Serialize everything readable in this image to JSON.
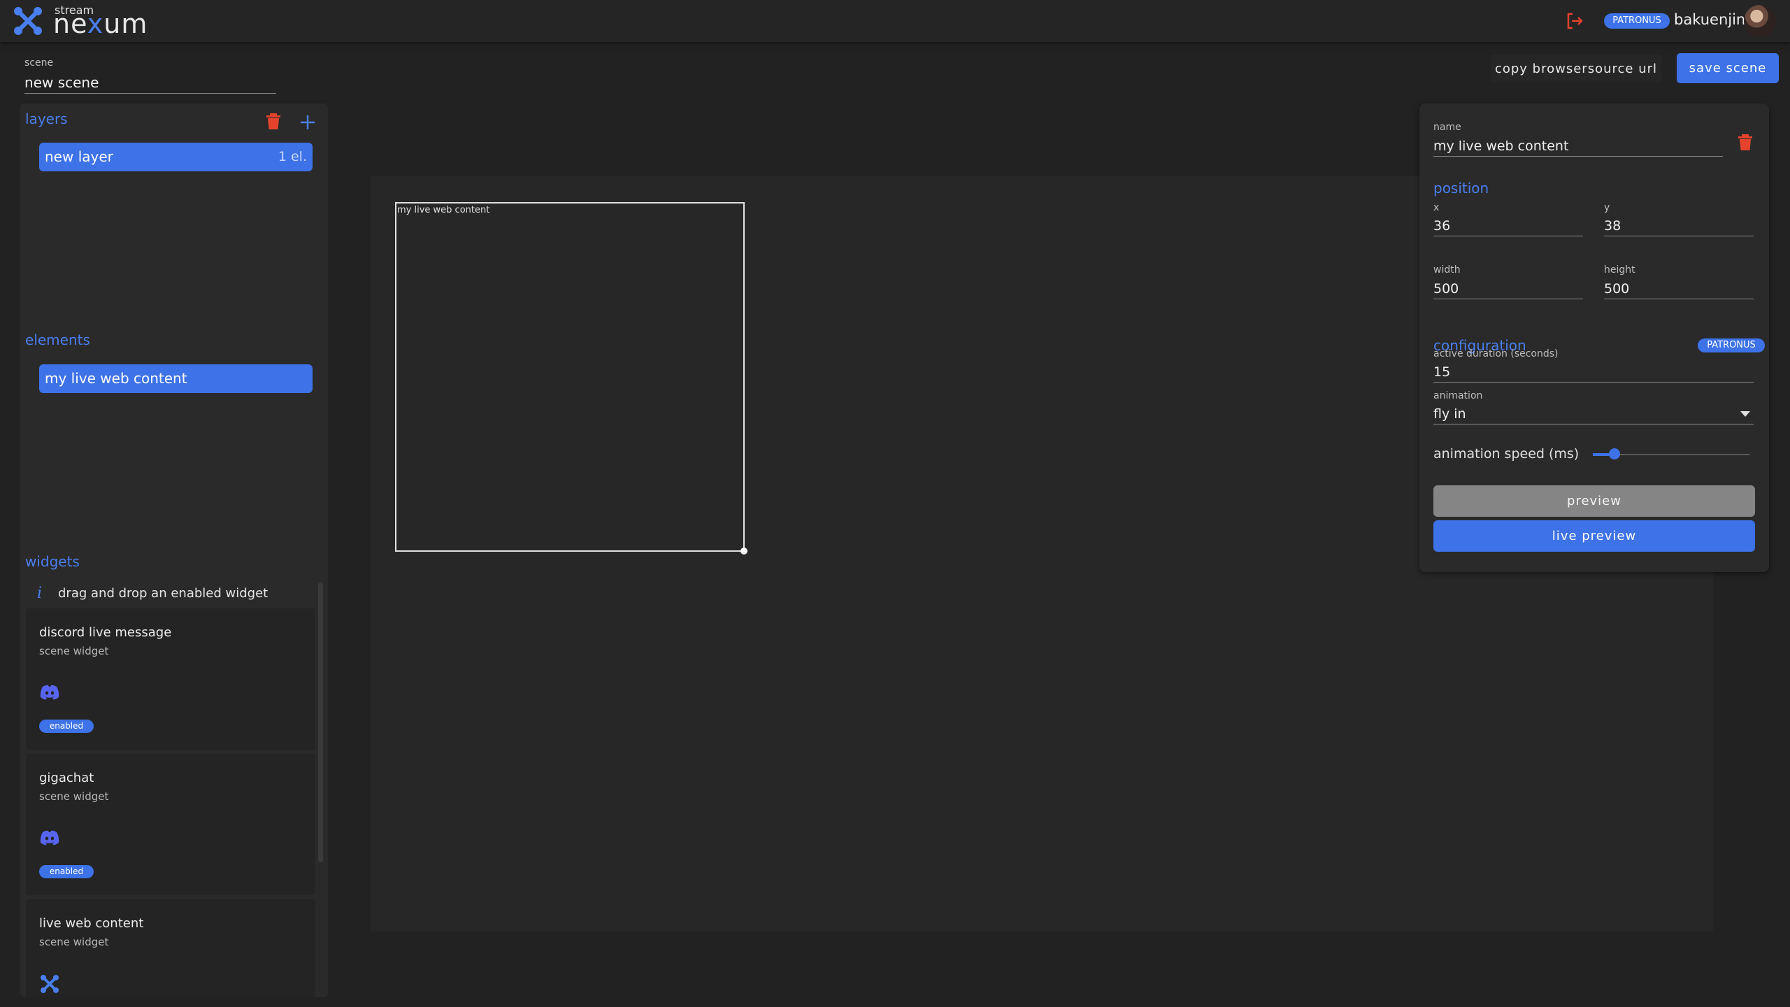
{
  "header": {
    "logo_small": "stream",
    "logo_big_pre": "ne",
    "logo_big_x": "x",
    "logo_big_post": "um",
    "badge": "PATRONUS",
    "username": "bakuenjin",
    "logout_icon": "logout-icon",
    "accent": "#3d72e8",
    "danger": "#e5432c"
  },
  "scene": {
    "label": "scene",
    "value": "new scene"
  },
  "actions": {
    "copy_url": "copy browsersource url",
    "save": "save scene"
  },
  "layers": {
    "title": "layers",
    "items": [
      {
        "label": "new layer",
        "count": "1 el."
      }
    ]
  },
  "elements": {
    "title": "elements",
    "items": [
      {
        "label": "my live web content"
      }
    ]
  },
  "widgets": {
    "title": "widgets",
    "info": "drag and drop an enabled widget",
    "items": [
      {
        "title": "discord live message",
        "subtitle": "scene widget",
        "icon": "discord-icon",
        "badge": "enabled"
      },
      {
        "title": "gigachat",
        "subtitle": "scene widget",
        "icon": "discord-icon",
        "badge": "enabled"
      },
      {
        "title": "live web content",
        "subtitle": "scene widget",
        "icon": "nexum-icon"
      }
    ]
  },
  "canvas": {
    "element_label": "my live web content"
  },
  "properties": {
    "name_label": "name",
    "name_value": "my live web content",
    "position_title": "position",
    "x_label": "x",
    "x_value": "36",
    "y_label": "y",
    "y_value": "38",
    "width_label": "width",
    "width_value": "500",
    "height_label": "height",
    "height_value": "500",
    "config_title": "configuration",
    "config_badge": "PATRONUS",
    "duration_label": "active duration (seconds)",
    "duration_value": "15",
    "animation_label": "animation",
    "animation_value": "fly in",
    "speed_label": "animation speed (ms)",
    "speed_level": 0.1,
    "preview": "preview",
    "live_preview": "live preview"
  }
}
